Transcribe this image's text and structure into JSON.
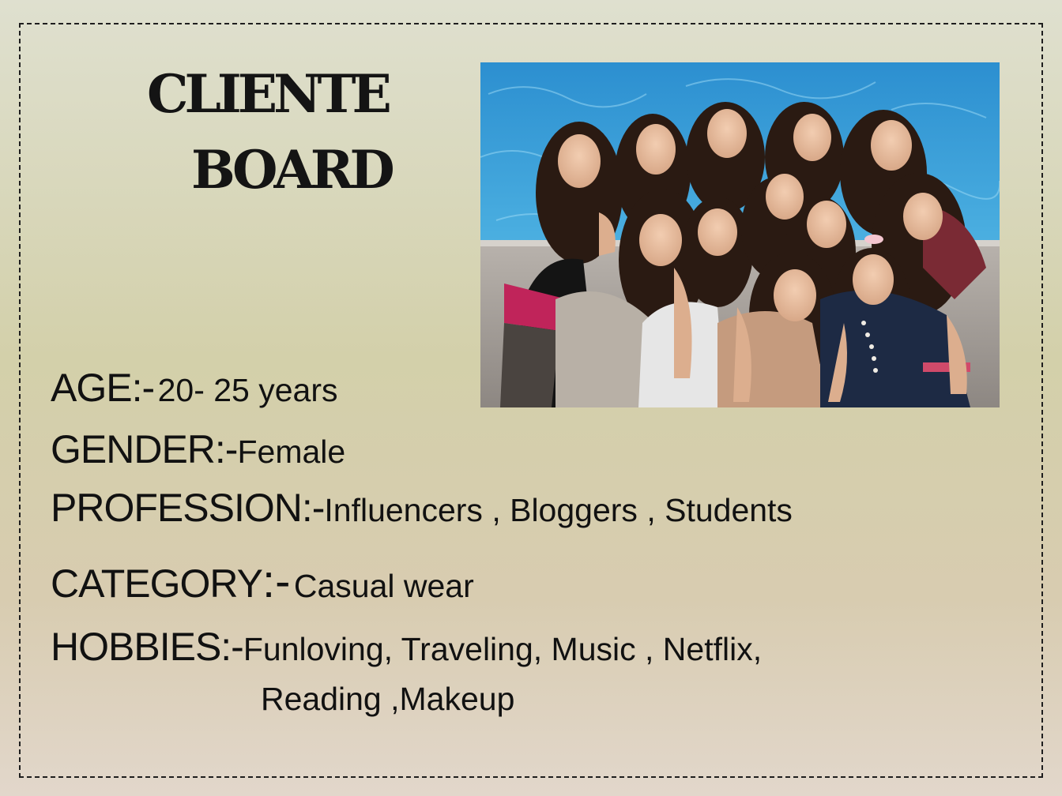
{
  "title": {
    "line1": "CLIENTE",
    "line2": "BOARD"
  },
  "photo": {
    "alt": "group photo"
  },
  "profile": {
    "age": {
      "label": "AGE:-",
      "value": "20- 25 years"
    },
    "gender": {
      "label": "GENDER:-",
      "value": "Female"
    },
    "profession": {
      "label": "PROFESSION:-",
      "value": "Influencers , Bloggers , Students"
    },
    "category": {
      "label": "CATEGORY",
      "sep": ":-",
      "value": "Casual wear"
    },
    "hobbies": {
      "label": "HOBBIES:-",
      "value_line1": "Funloving, Traveling, Music , Netflix,",
      "value_line2": "Reading ,Makeup"
    }
  },
  "colors": {
    "text": "#111111",
    "border": "#1e1e1e",
    "background_top": "#dfe0cf",
    "background_bottom": "#e2d7cb"
  }
}
